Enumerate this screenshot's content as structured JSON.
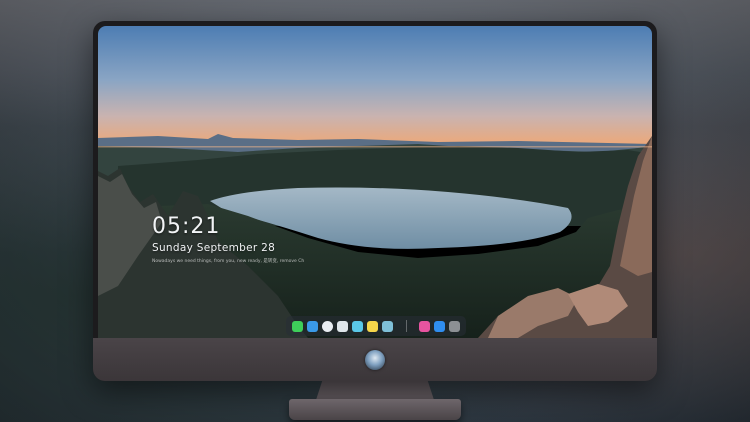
{
  "lock_screen": {
    "time": "05:21",
    "date": "Sunday September  28",
    "subtitle": "Nowadays we need things, from you, new ready, 是转变, remove Ch"
  },
  "dock": {
    "items": [
      {
        "name": "messages",
        "color": "#3ecf5a"
      },
      {
        "name": "finder",
        "color": "#3a9ae8"
      },
      {
        "name": "safari",
        "color": "#e9eef2"
      },
      {
        "name": "preview",
        "color": "#dfe6ea"
      },
      {
        "name": "files",
        "color": "#5ac8e8"
      },
      {
        "name": "notes",
        "color": "#f6d64a"
      },
      {
        "name": "photos",
        "color": "#7fc0d8"
      },
      {
        "name": "music",
        "color": "#e754a0"
      },
      {
        "name": "app-store",
        "color": "#2f8ef0"
      },
      {
        "name": "camera",
        "color": "#8c9094"
      }
    ]
  },
  "colors": {
    "sky_top": "#4f7fb4",
    "sky_horizon": "#e9a97a",
    "lake": "#8aa4b6",
    "monitor_frame": "#1c1b1d"
  }
}
